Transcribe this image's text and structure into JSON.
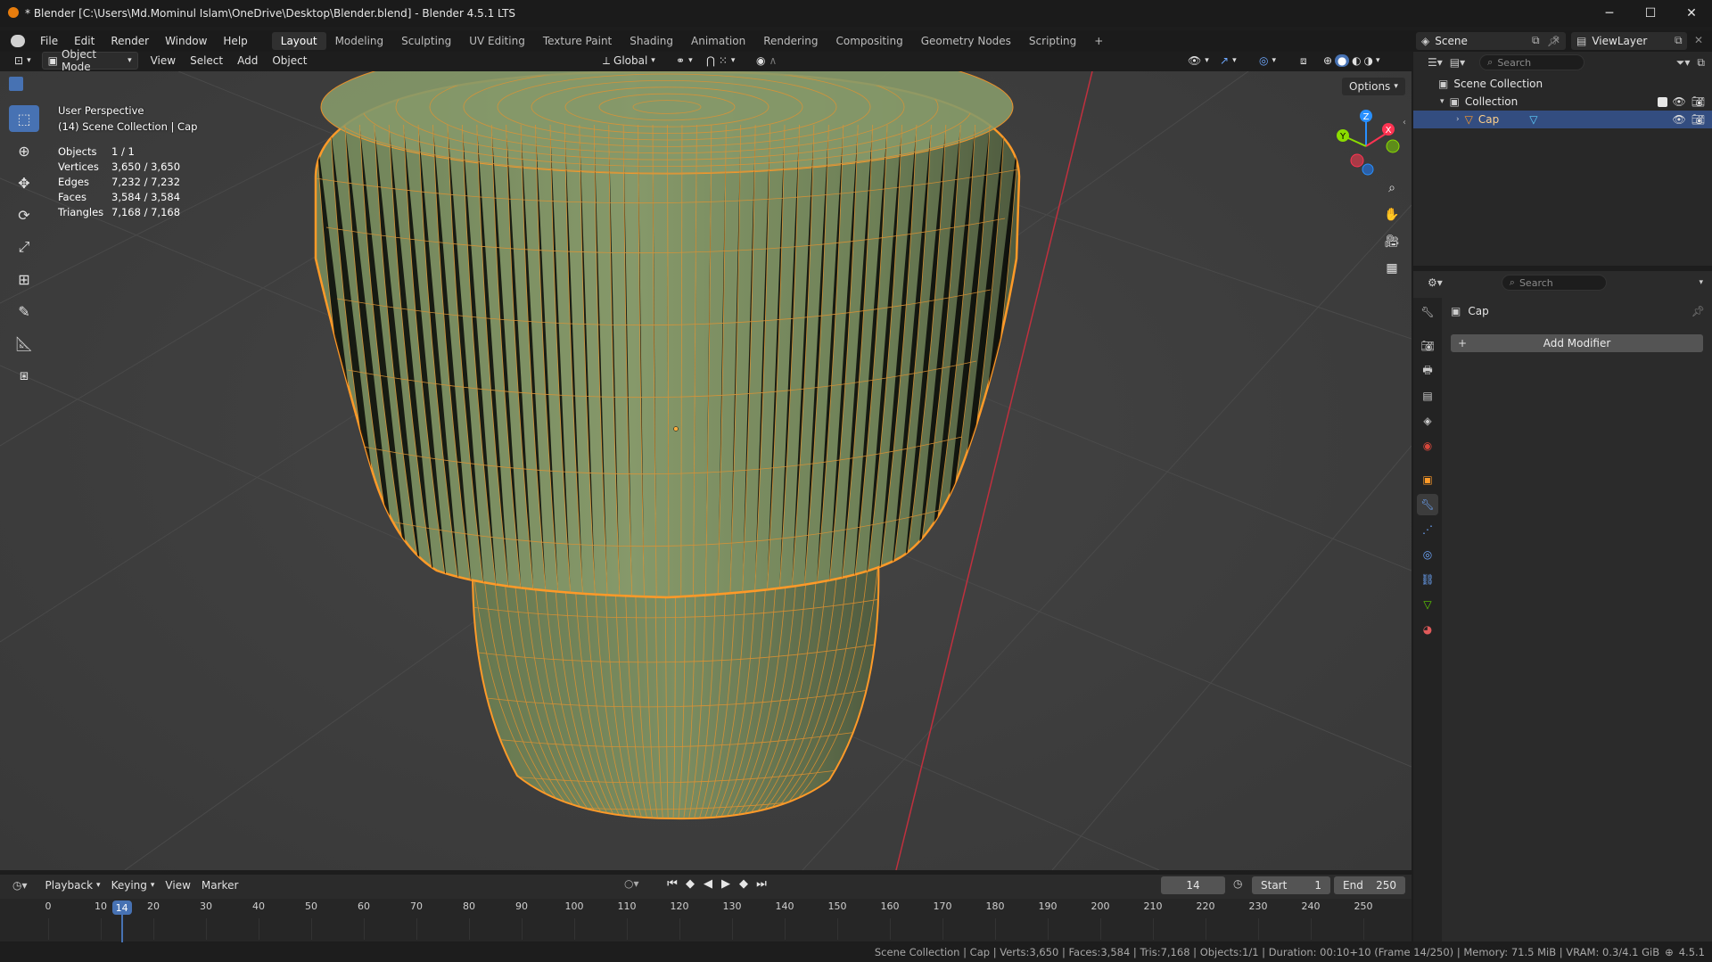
{
  "window": {
    "title": "* Blender [C:\\Users\\Md.Mominul Islam\\OneDrive\\Desktop\\Blender.blend] - Blender 4.5.1 LTS",
    "minimize": "─",
    "maximize": "☐",
    "close": "✕"
  },
  "menu": {
    "items": [
      "File",
      "Edit",
      "Render",
      "Window",
      "Help"
    ],
    "workspaces": [
      "Layout",
      "Modeling",
      "Sculpting",
      "UV Editing",
      "Texture Paint",
      "Shading",
      "Animation",
      "Rendering",
      "Compositing",
      "Geometry Nodes",
      "Scripting"
    ],
    "active_workspace": "Layout",
    "add_workspace": "+",
    "scene_label": "Scene",
    "viewlayer_label": "ViewLayer"
  },
  "viewport_header": {
    "mode": "Object Mode",
    "menus": [
      "View",
      "Select",
      "Add",
      "Object"
    ],
    "orientation": "Global",
    "options": "Options"
  },
  "viewport": {
    "perspective": "User Perspective",
    "context": "(14) Scene Collection | Cap",
    "stats": [
      {
        "label": "Objects",
        "value": "1 / 1"
      },
      {
        "label": "Vertices",
        "value": "3,650 / 3,650"
      },
      {
        "label": "Edges",
        "value": "7,232 / 7,232"
      },
      {
        "label": "Faces",
        "value": "3,584 / 3,584"
      },
      {
        "label": "Triangles",
        "value": "7,168 / 7,168"
      }
    ],
    "gizmo_axes": {
      "x": "X",
      "y": "Y",
      "z": "Z"
    },
    "colors": {
      "wire": "#ff9a28",
      "mesh": "#7f9464",
      "x_axis": "#ff3352",
      "y_axis": "#8bdc00",
      "z_axis": "#2890ff"
    }
  },
  "outliner": {
    "search_placeholder": "Search",
    "rows": [
      {
        "label": "Scene Collection"
      },
      {
        "label": "Collection"
      },
      {
        "label": "Cap"
      }
    ]
  },
  "properties": {
    "search_placeholder": "Search",
    "object_name": "Cap",
    "add_modifier": "Add Modifier"
  },
  "timeline": {
    "menus": [
      "Playback",
      "Keying",
      "View",
      "Marker"
    ],
    "current_frame": "14",
    "start_label": "Start",
    "start_value": "1",
    "end_label": "End",
    "end_value": "250",
    "ruler": [
      "0",
      "10",
      "20",
      "30",
      "40",
      "50",
      "60",
      "70",
      "80",
      "90",
      "100",
      "110",
      "120",
      "130",
      "140",
      "150",
      "160",
      "170",
      "180",
      "190",
      "200",
      "210",
      "220",
      "230",
      "240",
      "250"
    ],
    "playhead": "14"
  },
  "statusbar": {
    "text": "Scene Collection | Cap | Verts:3,650 | Faces:3,584 | Tris:7,168 | Objects:1/1 | Duration: 00:10+10 (Frame 14/250) | Memory: 71.5 MiB | VRAM: 0.3/4.1 GiB",
    "version": "4.5.1"
  }
}
